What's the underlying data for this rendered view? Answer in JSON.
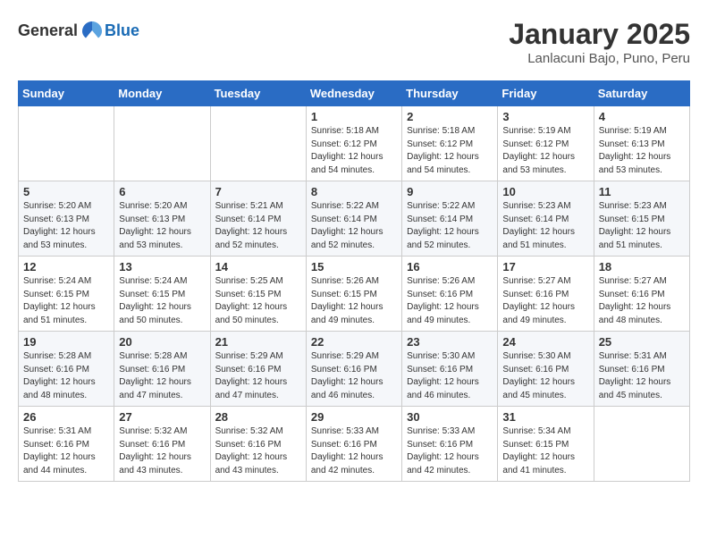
{
  "header": {
    "logo_general": "General",
    "logo_blue": "Blue",
    "month": "January 2025",
    "location": "Lanlacuni Bajo, Puno, Peru"
  },
  "weekdays": [
    "Sunday",
    "Monday",
    "Tuesday",
    "Wednesday",
    "Thursday",
    "Friday",
    "Saturday"
  ],
  "weeks": [
    [
      {
        "day": "",
        "info": ""
      },
      {
        "day": "",
        "info": ""
      },
      {
        "day": "",
        "info": ""
      },
      {
        "day": "1",
        "info": "Sunrise: 5:18 AM\nSunset: 6:12 PM\nDaylight: 12 hours\nand 54 minutes."
      },
      {
        "day": "2",
        "info": "Sunrise: 5:18 AM\nSunset: 6:12 PM\nDaylight: 12 hours\nand 54 minutes."
      },
      {
        "day": "3",
        "info": "Sunrise: 5:19 AM\nSunset: 6:12 PM\nDaylight: 12 hours\nand 53 minutes."
      },
      {
        "day": "4",
        "info": "Sunrise: 5:19 AM\nSunset: 6:13 PM\nDaylight: 12 hours\nand 53 minutes."
      }
    ],
    [
      {
        "day": "5",
        "info": "Sunrise: 5:20 AM\nSunset: 6:13 PM\nDaylight: 12 hours\nand 53 minutes."
      },
      {
        "day": "6",
        "info": "Sunrise: 5:20 AM\nSunset: 6:13 PM\nDaylight: 12 hours\nand 53 minutes."
      },
      {
        "day": "7",
        "info": "Sunrise: 5:21 AM\nSunset: 6:14 PM\nDaylight: 12 hours\nand 52 minutes."
      },
      {
        "day": "8",
        "info": "Sunrise: 5:22 AM\nSunset: 6:14 PM\nDaylight: 12 hours\nand 52 minutes."
      },
      {
        "day": "9",
        "info": "Sunrise: 5:22 AM\nSunset: 6:14 PM\nDaylight: 12 hours\nand 52 minutes."
      },
      {
        "day": "10",
        "info": "Sunrise: 5:23 AM\nSunset: 6:14 PM\nDaylight: 12 hours\nand 51 minutes."
      },
      {
        "day": "11",
        "info": "Sunrise: 5:23 AM\nSunset: 6:15 PM\nDaylight: 12 hours\nand 51 minutes."
      }
    ],
    [
      {
        "day": "12",
        "info": "Sunrise: 5:24 AM\nSunset: 6:15 PM\nDaylight: 12 hours\nand 51 minutes."
      },
      {
        "day": "13",
        "info": "Sunrise: 5:24 AM\nSunset: 6:15 PM\nDaylight: 12 hours\nand 50 minutes."
      },
      {
        "day": "14",
        "info": "Sunrise: 5:25 AM\nSunset: 6:15 PM\nDaylight: 12 hours\nand 50 minutes."
      },
      {
        "day": "15",
        "info": "Sunrise: 5:26 AM\nSunset: 6:15 PM\nDaylight: 12 hours\nand 49 minutes."
      },
      {
        "day": "16",
        "info": "Sunrise: 5:26 AM\nSunset: 6:16 PM\nDaylight: 12 hours\nand 49 minutes."
      },
      {
        "day": "17",
        "info": "Sunrise: 5:27 AM\nSunset: 6:16 PM\nDaylight: 12 hours\nand 49 minutes."
      },
      {
        "day": "18",
        "info": "Sunrise: 5:27 AM\nSunset: 6:16 PM\nDaylight: 12 hours\nand 48 minutes."
      }
    ],
    [
      {
        "day": "19",
        "info": "Sunrise: 5:28 AM\nSunset: 6:16 PM\nDaylight: 12 hours\nand 48 minutes."
      },
      {
        "day": "20",
        "info": "Sunrise: 5:28 AM\nSunset: 6:16 PM\nDaylight: 12 hours\nand 47 minutes."
      },
      {
        "day": "21",
        "info": "Sunrise: 5:29 AM\nSunset: 6:16 PM\nDaylight: 12 hours\nand 47 minutes."
      },
      {
        "day": "22",
        "info": "Sunrise: 5:29 AM\nSunset: 6:16 PM\nDaylight: 12 hours\nand 46 minutes."
      },
      {
        "day": "23",
        "info": "Sunrise: 5:30 AM\nSunset: 6:16 PM\nDaylight: 12 hours\nand 46 minutes."
      },
      {
        "day": "24",
        "info": "Sunrise: 5:30 AM\nSunset: 6:16 PM\nDaylight: 12 hours\nand 45 minutes."
      },
      {
        "day": "25",
        "info": "Sunrise: 5:31 AM\nSunset: 6:16 PM\nDaylight: 12 hours\nand 45 minutes."
      }
    ],
    [
      {
        "day": "26",
        "info": "Sunrise: 5:31 AM\nSunset: 6:16 PM\nDaylight: 12 hours\nand 44 minutes."
      },
      {
        "day": "27",
        "info": "Sunrise: 5:32 AM\nSunset: 6:16 PM\nDaylight: 12 hours\nand 43 minutes."
      },
      {
        "day": "28",
        "info": "Sunrise: 5:32 AM\nSunset: 6:16 PM\nDaylight: 12 hours\nand 43 minutes."
      },
      {
        "day": "29",
        "info": "Sunrise: 5:33 AM\nSunset: 6:16 PM\nDaylight: 12 hours\nand 42 minutes."
      },
      {
        "day": "30",
        "info": "Sunrise: 5:33 AM\nSunset: 6:16 PM\nDaylight: 12 hours\nand 42 minutes."
      },
      {
        "day": "31",
        "info": "Sunrise: 5:34 AM\nSunset: 6:15 PM\nDaylight: 12 hours\nand 41 minutes."
      },
      {
        "day": "",
        "info": ""
      }
    ]
  ]
}
